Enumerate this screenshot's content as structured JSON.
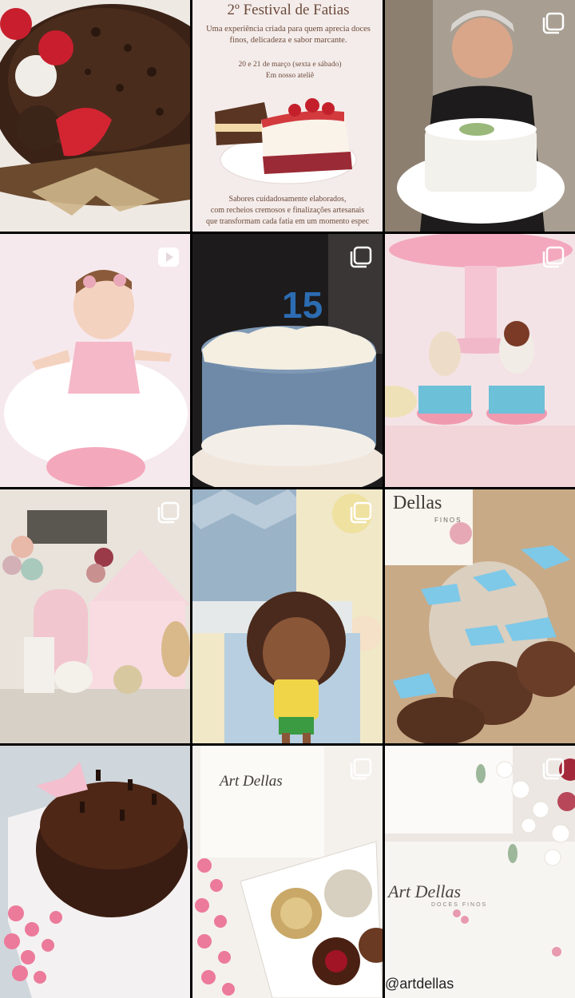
{
  "grid": {
    "posts": [
      {
        "type": "photo",
        "subject": "chocolate cake with strawberries and gold ribbon"
      },
      {
        "type": "photo",
        "subject": "festival poster with slices of cake",
        "text": {
          "title": "2º Festival de Fatias",
          "intro": "Uma experiência criada para quem aprecia doces finos, delicadeza e sabor marcante.",
          "date": "20 e 21 de março (sexta e sábado)",
          "place": "Em nosso ateliê",
          "outro_line1": "Sabores cuidadosamente elaborados,",
          "outro_line2": "com recheios cremosos e finalizações artesanais",
          "outro_line3": "que transformam cada fatia em um momento espec"
        }
      },
      {
        "type": "carousel",
        "subject": "smiling woman holding white cake"
      },
      {
        "type": "reel",
        "subject": "baby in pink tutu with cake smash"
      },
      {
        "type": "carousel",
        "subject": "blue and white cake with number 15"
      },
      {
        "type": "carousel",
        "subject": "puppy and bunny cake toppers on cupcakes"
      },
      {
        "type": "carousel",
        "subject": "pink farm party decoration"
      },
      {
        "type": "carousel",
        "subject": "cartoon boy party table"
      },
      {
        "type": "photo",
        "subject": "wrapped chocolate treats with blue ribbons",
        "text": {
          "brand": "Dellas",
          "brand_sub": "FINOS"
        }
      },
      {
        "type": "photo",
        "subject": "chocolate bundt cake with pink flowers"
      },
      {
        "type": "carousel",
        "subject": "Art Dellas box of bonbons",
        "text": {
          "brand": "Art Dellas"
        }
      },
      {
        "type": "carousel",
        "subject": "Art Dellas packaging with flowers",
        "text": {
          "brand": "Art Dellas",
          "brand_sub": "DOCES FINOS",
          "handle": "@artdellas"
        }
      }
    ]
  },
  "icons": {
    "carousel": "carousel-icon",
    "reel": "reel-icon"
  },
  "colors": {
    "background": "#000000",
    "badge": "#ffffff"
  }
}
